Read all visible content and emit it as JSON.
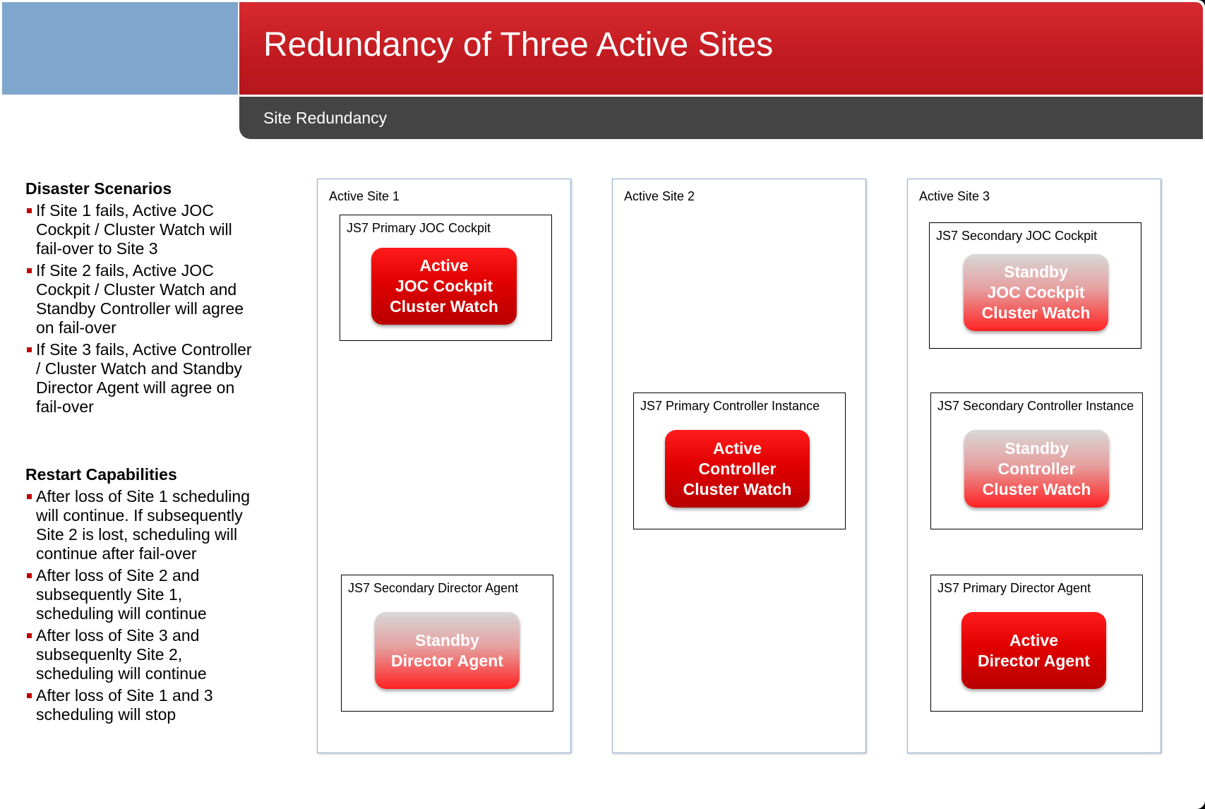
{
  "header": {
    "title": "Redundancy of Three Active Sites",
    "subtitle": "Site Redundancy"
  },
  "disaster": {
    "heading": "Disaster Scenarios",
    "items": [
      "If Site 1 fails, Active JOC Cockpit / Cluster Watch will fail-over to Site 3",
      "If Site 2 fails, Active JOC Cockpit / Cluster Watch and Standby Controller will agree on fail-over",
      "If Site 3 fails, Active Controller / Cluster Watch and Standby Director Agent will agree on fail-over"
    ]
  },
  "restart": {
    "heading": "Restart Capabilities",
    "items": [
      "After loss of Site 1 scheduling will continue. If subsequently Site 2 is lost, scheduling will continue after fail-over",
      "After loss of Site 2 and subsequently Site 1, scheduling will continue",
      "After loss of Site 3 and subsequenlty Site 2, scheduling will continue",
      "After loss of Site 1 and 3 scheduling will stop"
    ]
  },
  "sites": [
    {
      "label": "Active Site 1",
      "components": [
        {
          "label": "JS7 Primary JOC Cockpit",
          "state": "active",
          "lines": [
            "Active",
            "JOC Cockpit",
            "Cluster Watch"
          ]
        },
        {
          "label": "JS7 Secondary Director Agent",
          "state": "standby",
          "lines": [
            "Standby",
            "Director Agent"
          ]
        }
      ]
    },
    {
      "label": "Active Site 2",
      "components": [
        {
          "label": "JS7 Primary Controller Instance",
          "state": "active",
          "lines": [
            "Active",
            "Controller",
            "Cluster Watch"
          ]
        }
      ]
    },
    {
      "label": "Active Site 3",
      "components": [
        {
          "label": "JS7 Secondary JOC Cockpit",
          "state": "standby",
          "lines": [
            "Standby",
            "JOC Cockpit",
            "Cluster Watch"
          ]
        },
        {
          "label": "JS7 Secondary Controller Instance",
          "state": "standby",
          "lines": [
            "Standby",
            "Controller",
            "Cluster Watch"
          ]
        },
        {
          "label": "JS7 Primary Director Agent",
          "state": "active",
          "lines": [
            "Active",
            "Director Agent"
          ]
        }
      ]
    }
  ],
  "colors": {
    "header_red": "#c8191f",
    "header_blue": "#7fa6cd",
    "subheader_gray": "#444444",
    "bullet_red": "#c00000",
    "active_red": "#e00000"
  }
}
